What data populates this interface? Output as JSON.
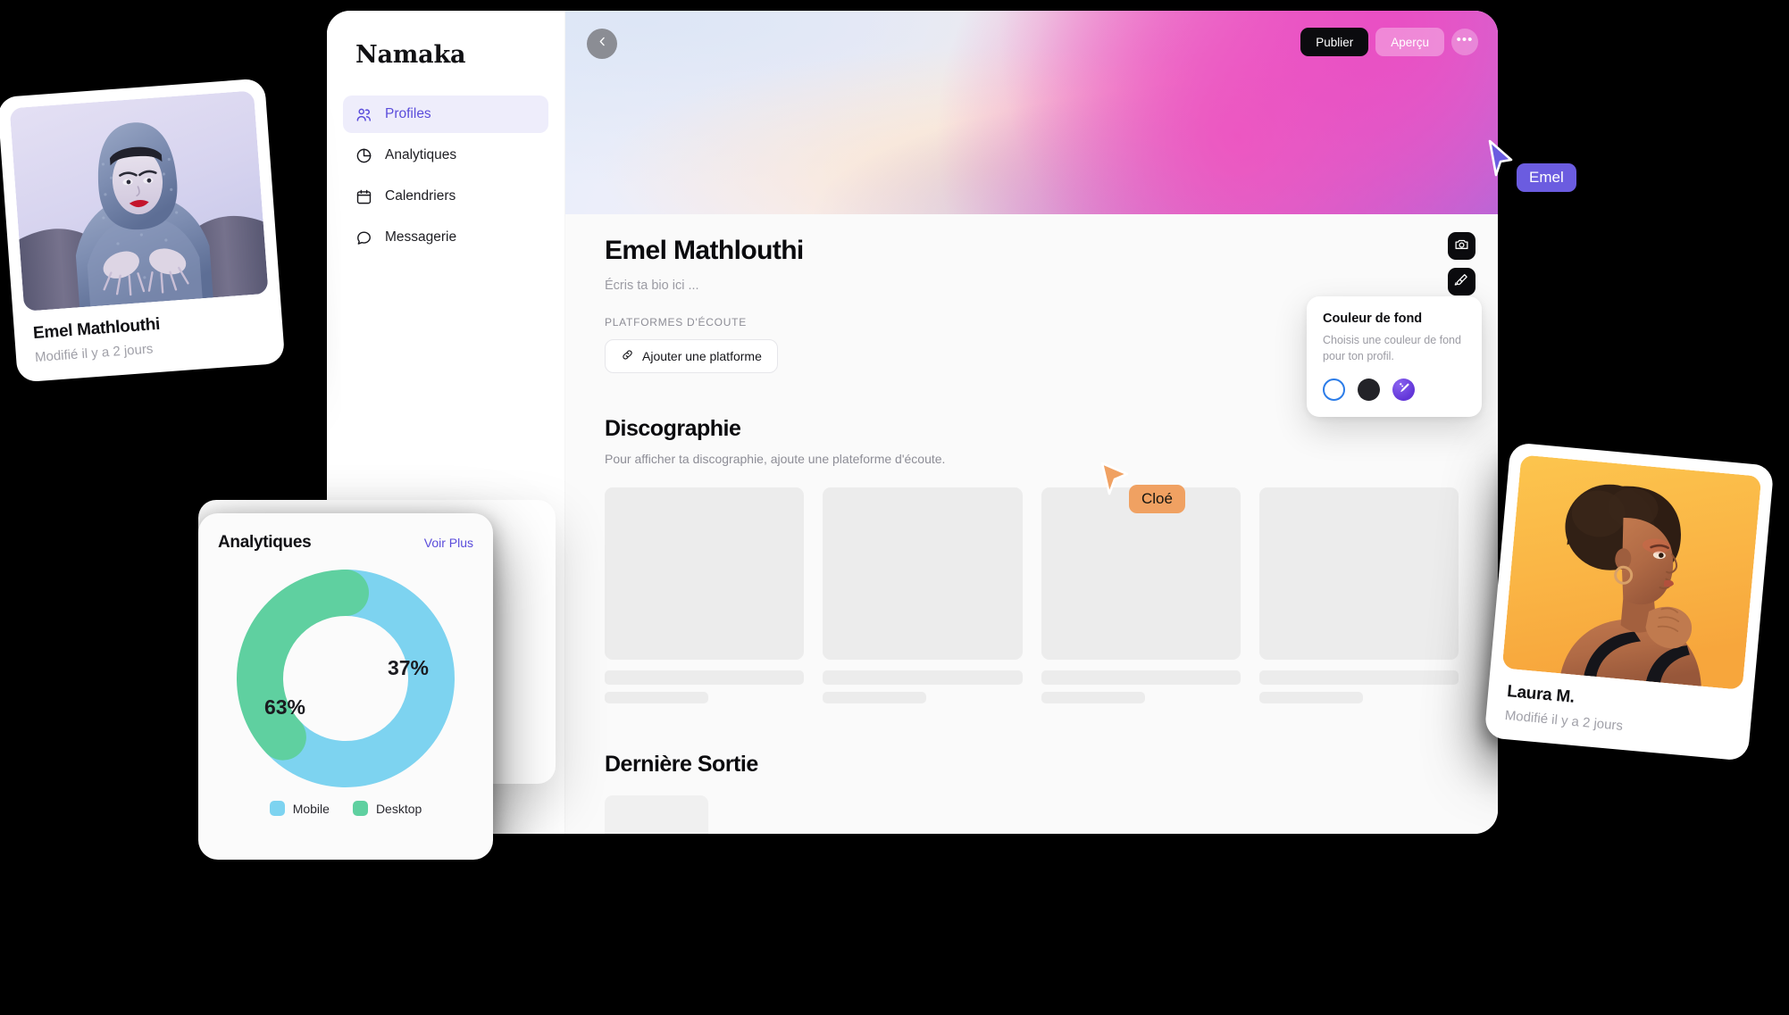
{
  "app": {
    "brand": "Namaka"
  },
  "sidebar": {
    "items": [
      {
        "label": "Profiles",
        "icon": "users-icon",
        "active": true
      },
      {
        "label": "Analytiques",
        "icon": "pie-chart-icon",
        "active": false
      },
      {
        "label": "Calendriers",
        "icon": "calendar-icon",
        "active": false
      },
      {
        "label": "Messagerie",
        "icon": "chat-icon",
        "active": false
      }
    ]
  },
  "hero": {
    "back_icon": "chevron-left-icon",
    "publish_label": "Publier",
    "preview_label": "Aperçu",
    "more_label": "•••",
    "camera_icon": "camera-icon",
    "brush_icon": "paintbrush-icon"
  },
  "profile": {
    "name": "Emel Mathlouthi",
    "bio_placeholder": "Écris ta bio ici ...",
    "platforms_kicker": "PLATFORMES D'ÉCOUTE",
    "add_platform_label": "Ajouter une platforme",
    "add_platform_icon": "link-icon"
  },
  "discography": {
    "title": "Discographie",
    "subtitle": "Pour afficher ta discographie, ajoute une plateforme d'écoute.",
    "placeholder_count": 4
  },
  "latest_release": {
    "title": "Dernière Sortie"
  },
  "color_popover": {
    "title": "Couleur de fond",
    "description": "Choisis une couleur de fond pour ton profil.",
    "swatches": [
      {
        "name": "white-swatch",
        "color": "#ffffff",
        "selected": true,
        "ring": "#2b7ce8"
      },
      {
        "name": "dark-swatch",
        "color": "#232328",
        "selected": false
      },
      {
        "name": "magic-swatch",
        "color": "#6236d8",
        "selected": false,
        "icon": "sparkle-wand-icon"
      }
    ]
  },
  "analytics": {
    "title": "Analytiques",
    "link_label": "Voir Plus"
  },
  "chart_data": {
    "type": "pie",
    "title": "Analytiques",
    "variant": "donut",
    "labels": [
      "Mobile",
      "Desktop"
    ],
    "values": [
      63,
      37
    ],
    "value_labels": [
      "63%",
      "37%"
    ],
    "colors": [
      "#7dd3f0",
      "#5fd0a0"
    ],
    "legend": "bottom-center",
    "units": "%",
    "total": 100
  },
  "profile_cards": [
    {
      "name": "Emel Mathlouthi",
      "meta": "Modifié il y a 2 jours",
      "photo_desc": "portrait of woman in silver chainmail hood, blue toned"
    },
    {
      "name": "Laura M.",
      "meta": "Modifié il y a 2 jours",
      "photo_desc": "profile portrait of woman with afro on orange background"
    }
  ],
  "cursors": [
    {
      "label": "Emel",
      "color": "#6b5ce0",
      "text_color": "#ffffff"
    },
    {
      "label": "Cloé",
      "color": "#f0a162",
      "text_color": "#14140f"
    }
  ]
}
